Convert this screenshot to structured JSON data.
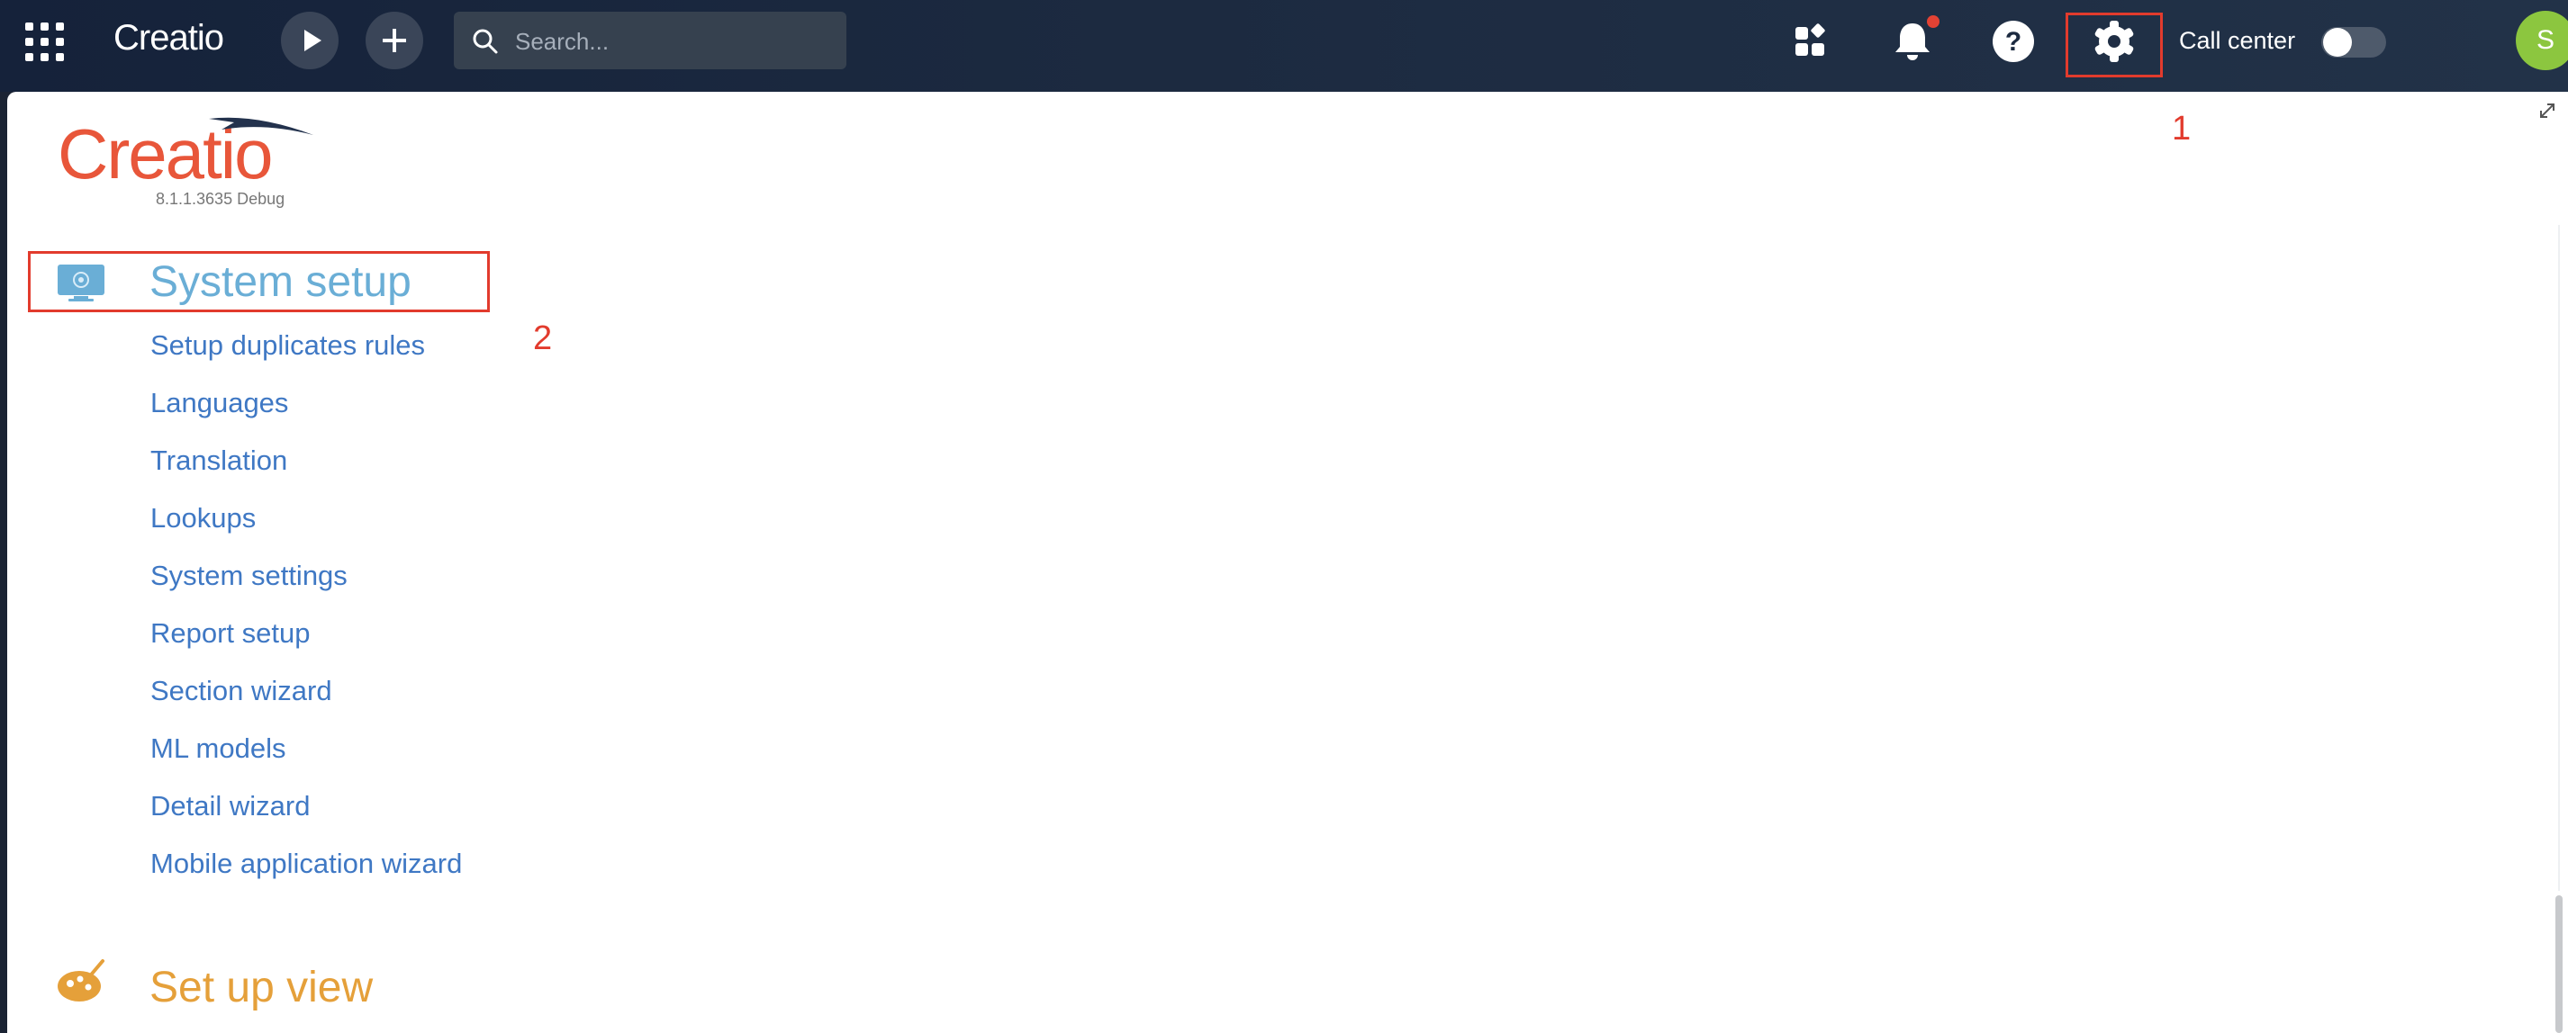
{
  "topbar": {
    "brand": "Creatio",
    "search": {
      "placeholder": "Search..."
    },
    "call_center_label": "Call center",
    "call_center_enabled": false,
    "avatar_initial": "S",
    "icons": [
      "apps-grid-icon",
      "play-icon",
      "plus-icon",
      "search-icon",
      "widgets-icon",
      "bell-icon",
      "help-icon",
      "gear-icon"
    ],
    "notification_dot_color": "#e34234"
  },
  "logo": {
    "text": "Creatio",
    "version": "8.1.1.3635 Debug"
  },
  "annotations": {
    "gear": "1",
    "system_setup": "2",
    "color": "#e23b2d"
  },
  "system_setup": {
    "title": "System setup",
    "icon": "monitor-gear-icon",
    "links": [
      "Setup duplicates rules",
      "Languages",
      "Translation",
      "Lookups",
      "System settings",
      "Report setup",
      "Section wizard",
      "ML models",
      "Detail wizard",
      "Mobile application wizard"
    ]
  },
  "set_up_view": {
    "title": "Set up view",
    "icon": "palette-icon"
  },
  "colors": {
    "link": "#3f78c4",
    "section_title": "#6aaed6",
    "view_title": "#e5a03a",
    "avatar": "#8cc63f",
    "brand_logo": "#e8563a"
  }
}
